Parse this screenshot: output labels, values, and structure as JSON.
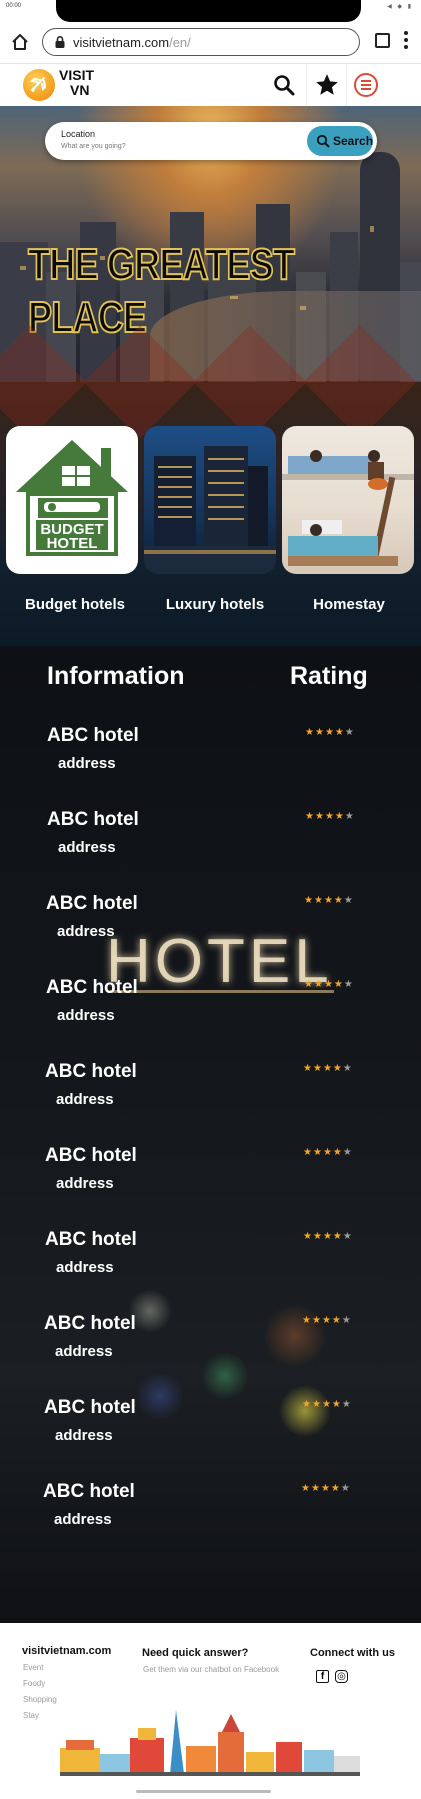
{
  "status": {
    "time": "00:00",
    "icons": "◀ ◆ ▮"
  },
  "browser": {
    "url_host": "visitvietnam.com",
    "url_path": "/en/"
  },
  "site": {
    "logo_line1": "VISIT",
    "logo_line2": "VN"
  },
  "search": {
    "location_label": "Location",
    "placeholder": "What are you going?",
    "button_label": "Search"
  },
  "hero": {
    "title_line1": "THE GREATEST",
    "title_line2": "PLACE"
  },
  "categories": [
    {
      "label": "Budget hotels",
      "badge_line1": "BUDGET",
      "badge_line2": "HOTEL"
    },
    {
      "label": "Luxury hotels"
    },
    {
      "label": "Homestay"
    }
  ],
  "list": {
    "col_info": "Information",
    "col_rating": "Rating",
    "sign": "HOTEL",
    "rows": [
      {
        "name": "ABC hotel",
        "address": "address",
        "rating": 4,
        "max": 5
      },
      {
        "name": "ABC hotel",
        "address": "address",
        "rating": 4,
        "max": 5
      },
      {
        "name": "ABC hotel",
        "address": "address",
        "rating": 4,
        "max": 5
      },
      {
        "name": "ABC hotel",
        "address": "address",
        "rating": 4,
        "max": 5
      },
      {
        "name": "ABC hotel",
        "address": "address",
        "rating": 4,
        "max": 5
      },
      {
        "name": "ABC hotel",
        "address": "address",
        "rating": 4,
        "max": 5
      },
      {
        "name": "ABC hotel",
        "address": "address",
        "rating": 4,
        "max": 5
      },
      {
        "name": "ABC hotel",
        "address": "address",
        "rating": 4,
        "max": 5
      },
      {
        "name": "ABC hotel",
        "address": "address",
        "rating": 4,
        "max": 5
      },
      {
        "name": "ABC hotel",
        "address": "address",
        "rating": 4,
        "max": 5
      }
    ]
  },
  "footer": {
    "site_name": "visitvietnam.com",
    "links": [
      "Event",
      "Foody",
      "Shopping",
      "Stay"
    ],
    "help_title": "Need quick answer?",
    "help_text": "Get them via our chatbot on Facebook",
    "connect_title": "Connect with us",
    "social_icons": [
      "facebook-icon",
      "instagram-icon"
    ]
  },
  "colors": {
    "accent": "#3aa0bf",
    "star": "#f2a52a",
    "logo": "#f39a1a",
    "title_outline": "#e1c35a"
  }
}
